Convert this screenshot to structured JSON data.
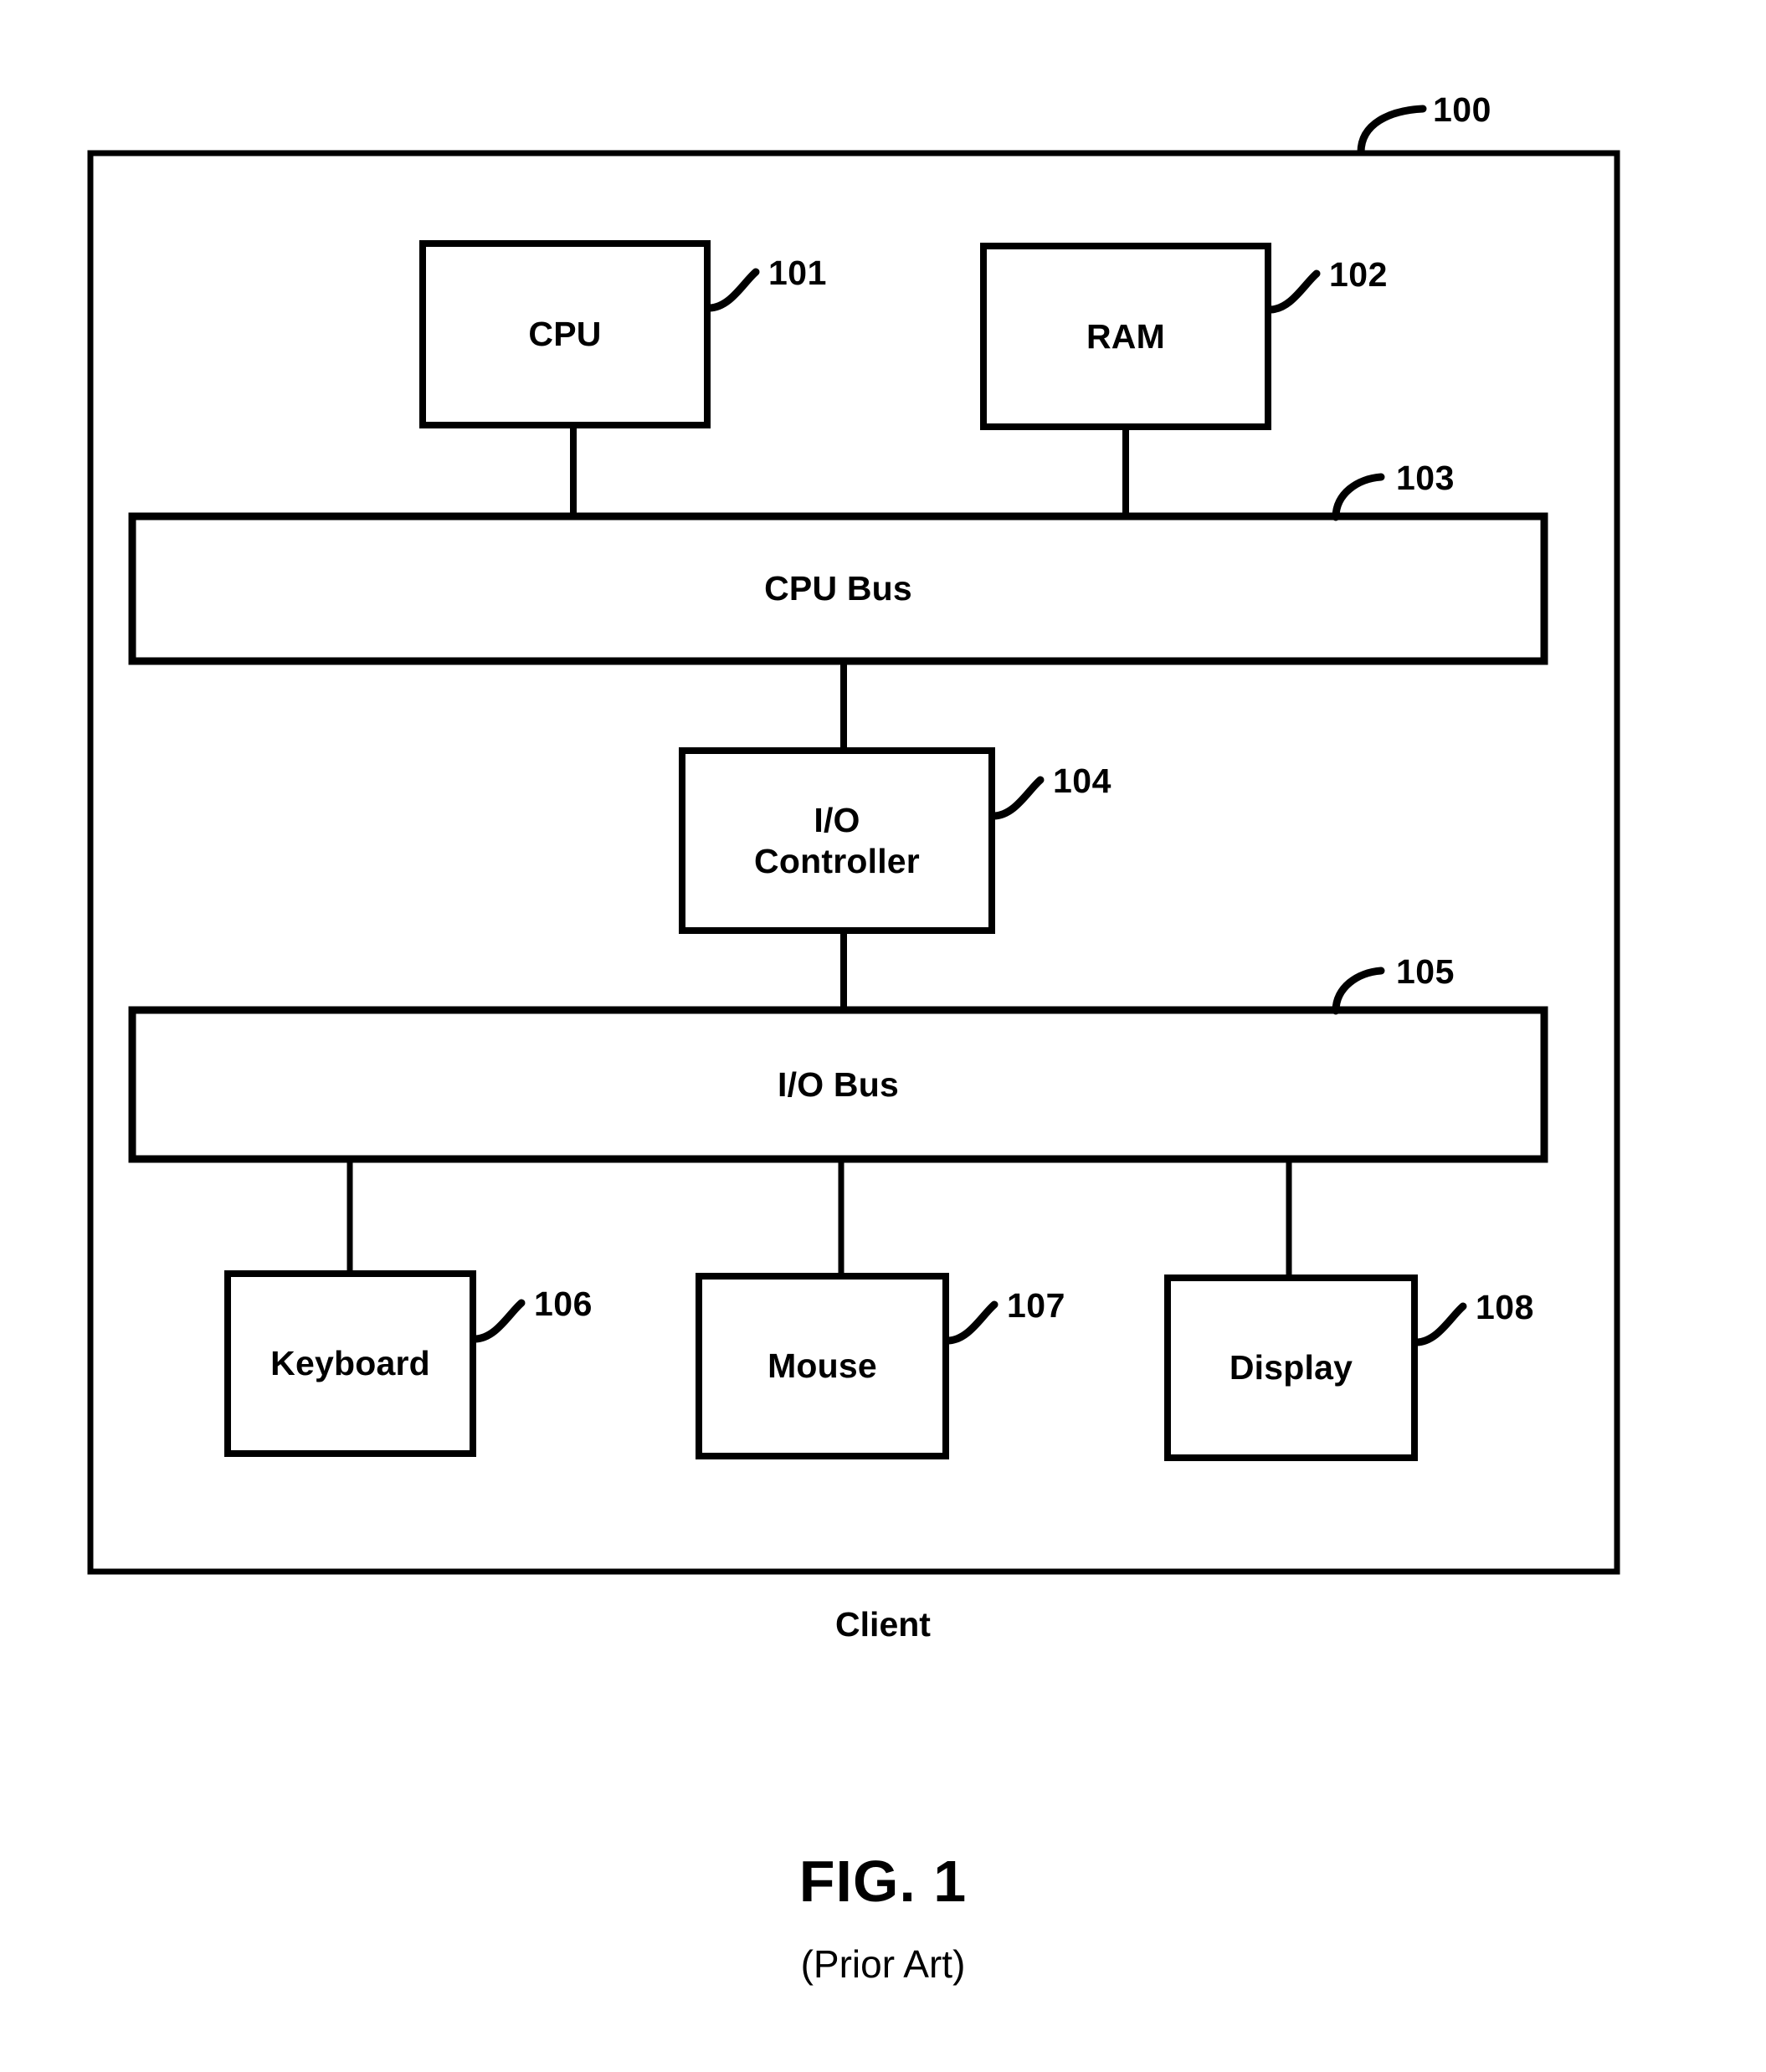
{
  "figure": {
    "caption": "FIG. 1",
    "subcaption": "(Prior Art)",
    "outer_system_label": "Client",
    "outer_system_ref": "100"
  },
  "blocks": [
    {
      "id": "cpu",
      "label": "CPU",
      "ref": "101"
    },
    {
      "id": "ram",
      "label": "RAM",
      "ref": "102"
    },
    {
      "id": "cpu_bus",
      "label": "CPU Bus",
      "ref": "103"
    },
    {
      "id": "io_ctrl",
      "label": "I/O\nController",
      "ref": "104"
    },
    {
      "id": "io_bus",
      "label": "I/O Bus",
      "ref": "105"
    },
    {
      "id": "keyboard",
      "label": "Keyboard",
      "ref": "106"
    },
    {
      "id": "mouse",
      "label": "Mouse",
      "ref": "107"
    },
    {
      "id": "display",
      "label": "Display",
      "ref": "108"
    }
  ],
  "colors": {
    "ink": "#000000",
    "paper": "#ffffff"
  }
}
